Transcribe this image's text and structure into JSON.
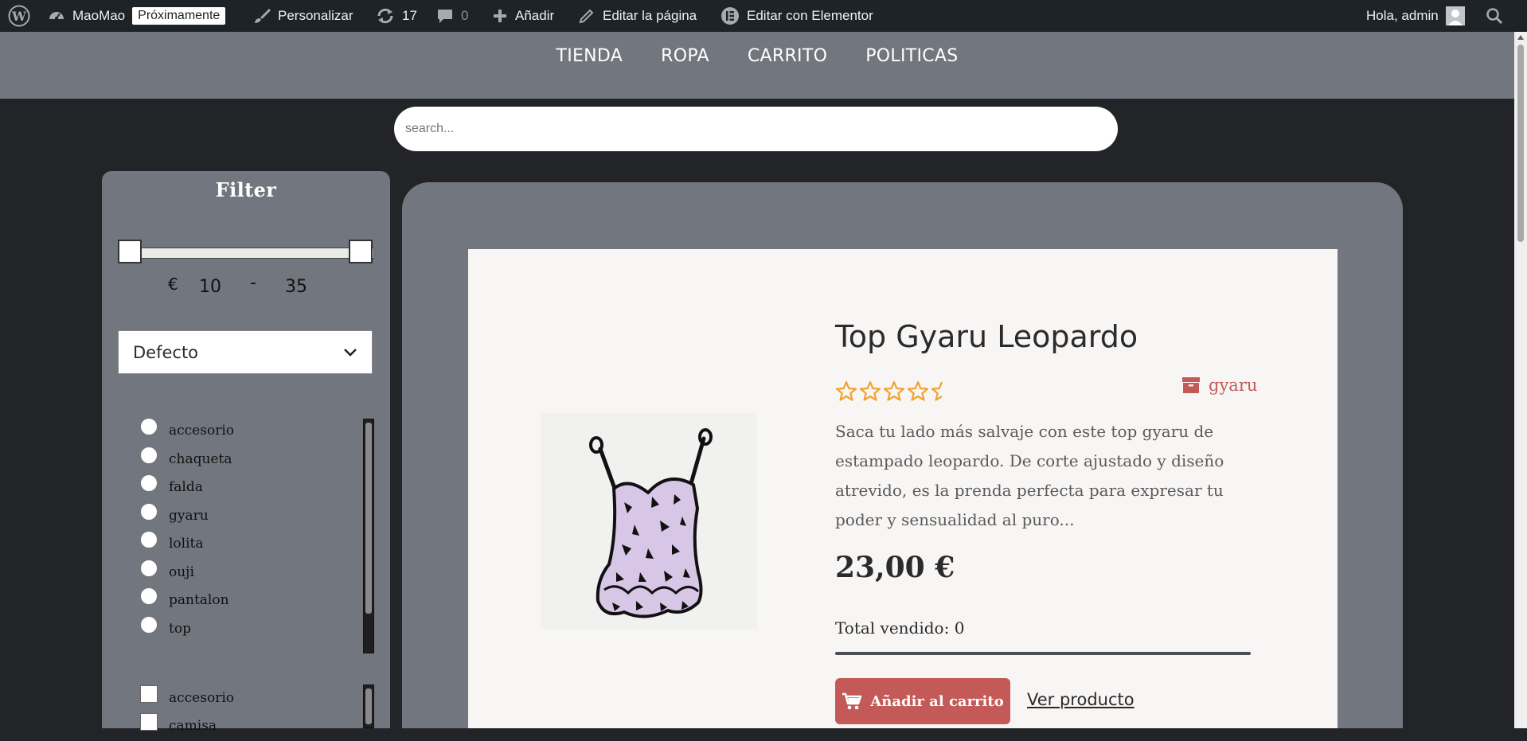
{
  "adminbar": {
    "site_name": "MaoMao",
    "badge": "Próximamente",
    "customize": "Personalizar",
    "updates_count": "17",
    "comments_count": "0",
    "add_new": "Añadir",
    "edit_page": "Editar la página",
    "edit_elementor": "Editar con Elementor",
    "greeting": "Hola, admin"
  },
  "nav": {
    "items": [
      "TIENDA",
      "ROPA",
      "CARRITO",
      "POLITICAS"
    ]
  },
  "search": {
    "placeholder": "search..."
  },
  "filter": {
    "title": "Filter",
    "currency": "€",
    "min": "10",
    "separator": "-",
    "max": "35",
    "sort_selected": "Defecto",
    "categories": [
      "accesorio",
      "chaqueta",
      "falda",
      "gyaru",
      "lolita",
      "ouji",
      "pantalon",
      "top"
    ],
    "types": [
      "accesorio",
      "camisa"
    ]
  },
  "product": {
    "title": "Top Gyaru Leopardo",
    "rating": 4.5,
    "category": "gyaru",
    "description": "Saca tu lado más salvaje con este top gyaru de estampado leopardo. De corte ajustado y diseño atrevido, es la prenda perfecta para expresar tu poder y sensualidad al puro...",
    "price": "23,00 €",
    "sold_label": "Total vendido: 0",
    "add_to_cart": "Añadir al carrito",
    "view": "Ver producto"
  },
  "colors": {
    "accent": "#c45a57",
    "panel": "#72767e",
    "background": "#232427",
    "star": "#f0a22b"
  }
}
